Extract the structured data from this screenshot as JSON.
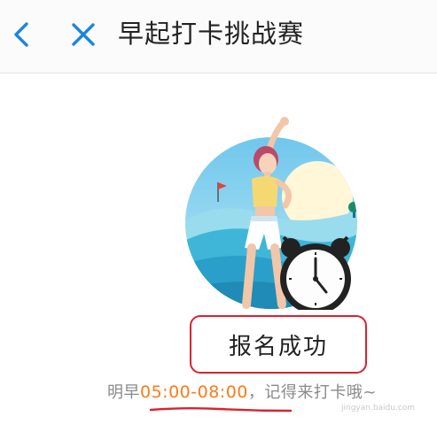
{
  "header": {
    "title": "早起打卡挑战赛",
    "back_icon": "chevron-left-icon",
    "close_icon": "close-icon",
    "accent_color": "#1a86e0"
  },
  "hero": {
    "illustration": "stretching-woman-with-alarm-clock"
  },
  "signup": {
    "status_text": "报名成功"
  },
  "notice": {
    "prefix": "明早",
    "time_range": "05:00-08:00",
    "suffix": "，记得来打卡哦~",
    "time_color": "#ff7a17"
  },
  "annotation": {
    "box_color": "#d9232e"
  },
  "watermark": {
    "text": "jingyan.baidu.com"
  }
}
